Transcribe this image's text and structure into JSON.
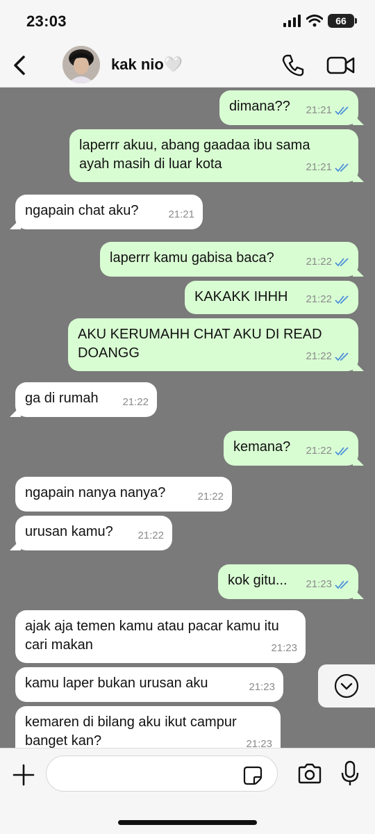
{
  "status_bar": {
    "time": "23:03",
    "battery": "66"
  },
  "header": {
    "contact_name": "kak nio🤍"
  },
  "messages": [
    {
      "dir": "out",
      "text": "dimana??",
      "time": "21:21"
    },
    {
      "dir": "out",
      "text": "laperrr akuu, abang gaadaa ibu sama ayah masih di luar kota",
      "time": "21:21"
    },
    {
      "dir": "in",
      "text": "ngapain chat aku?",
      "time": "21:21"
    },
    {
      "dir": "out",
      "text": "laperrr kamu gabisa baca?",
      "time": "21:22"
    },
    {
      "dir": "out",
      "text": "KAKAKK IHHH",
      "time": "21:22"
    },
    {
      "dir": "out",
      "text": "AKU KERUMAHH CHAT AKU DI READ DOANGG",
      "time": "21:22"
    },
    {
      "dir": "in",
      "text": "ga di rumah",
      "time": "21:22"
    },
    {
      "dir": "out",
      "text": "kemana?",
      "time": "21:22"
    },
    {
      "dir": "in",
      "text": "ngapain nanya nanya?",
      "time": "21:22"
    },
    {
      "dir": "in",
      "text": "urusan kamu?",
      "time": "21:22"
    },
    {
      "dir": "out",
      "text": "kok gitu...",
      "time": "21:23"
    },
    {
      "dir": "in",
      "text": "ajak aja temen kamu atau pacar kamu itu cari makan",
      "time": "21:23"
    },
    {
      "dir": "in",
      "text": "kamu laper bukan urusan aku",
      "time": "21:23"
    },
    {
      "dir": "in",
      "text": "kemaren di bilang aku ikut campur banget kan?",
      "time": "21:23"
    }
  ],
  "colors": {
    "outgoing": "#d9fdd3",
    "incoming": "#ffffff",
    "chat_bg": "#7a7a7a",
    "read_check": "#4a90d9"
  }
}
